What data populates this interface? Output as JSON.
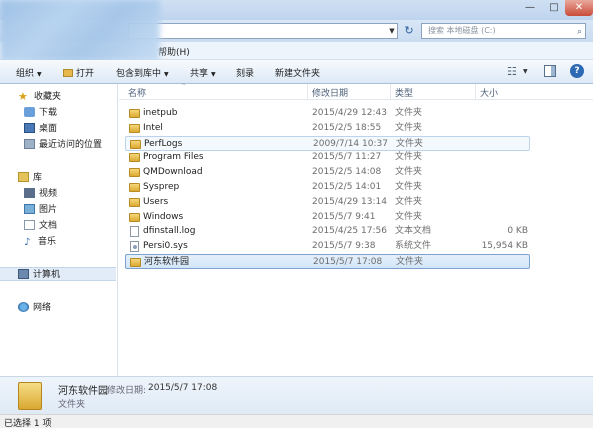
{
  "window": {
    "minimize_glyph": "—",
    "maximize_glyph": "□",
    "close_glyph": "✕"
  },
  "address": {
    "dropdown_glyph": "▼",
    "refresh_glyph": "↻",
    "search_placeholder": "搜索 本地磁盘 (C:)",
    "search_icon": "search-icon"
  },
  "menu": {
    "help_label": "帮助(H)"
  },
  "toolbar": {
    "organize": "组织",
    "open": "打开",
    "include_in_library": "包含到库中",
    "share": "共享",
    "burn": "刻录",
    "new_folder": "新建文件夹",
    "dropdown_glyph": "▼",
    "view_glyph": "☷",
    "help_glyph": "?"
  },
  "nav": {
    "favorites": "收藏夹",
    "downloads": "下载",
    "desktop": "桌面",
    "recent": "最近访问的位置",
    "libraries": "库",
    "videos": "视频",
    "pictures": "图片",
    "documents": "文档",
    "music": "音乐",
    "computer": "计算机",
    "network": "网络"
  },
  "columns": {
    "name": "名称",
    "date": "修改日期",
    "type": "类型",
    "size": "大小",
    "sort_glyph": "^"
  },
  "files": [
    {
      "name": "inetpub",
      "date": "2015/4/29 12:43",
      "type": "文件夹",
      "size": "",
      "kind": "folder"
    },
    {
      "name": "Intel",
      "date": "2015/2/5 18:55",
      "type": "文件夹",
      "size": "",
      "kind": "folder"
    },
    {
      "name": "PerfLogs",
      "date": "2009/7/14 10:37",
      "type": "文件夹",
      "size": "",
      "kind": "folder"
    },
    {
      "name": "Program Files",
      "date": "2015/5/7 11:27",
      "type": "文件夹",
      "size": "",
      "kind": "folder"
    },
    {
      "name": "QMDownload",
      "date": "2015/2/5 14:08",
      "type": "文件夹",
      "size": "",
      "kind": "folder"
    },
    {
      "name": "Sysprep",
      "date": "2015/2/5 14:01",
      "type": "文件夹",
      "size": "",
      "kind": "folder"
    },
    {
      "name": "Users",
      "date": "2015/4/29 13:14",
      "type": "文件夹",
      "size": "",
      "kind": "folder"
    },
    {
      "name": "Windows",
      "date": "2015/5/7 9:41",
      "type": "文件夹",
      "size": "",
      "kind": "folder"
    },
    {
      "name": "dfinstall.log",
      "date": "2015/4/25 17:56",
      "type": "文本文档",
      "size": "0 KB",
      "kind": "log"
    },
    {
      "name": "Persi0.sys",
      "date": "2015/5/7 9:38",
      "type": "系统文件",
      "size": "15,954 KB",
      "kind": "sys"
    },
    {
      "name": "河东软件园",
      "date": "2015/5/7 17:08",
      "type": "文件夹",
      "size": "",
      "kind": "folder"
    }
  ],
  "details": {
    "name": "河东软件园",
    "modified_label": "修改日期:",
    "modified_value": "2015/5/7 17:08",
    "type": "文件夹"
  },
  "status": {
    "text": "已选择 1 项"
  }
}
